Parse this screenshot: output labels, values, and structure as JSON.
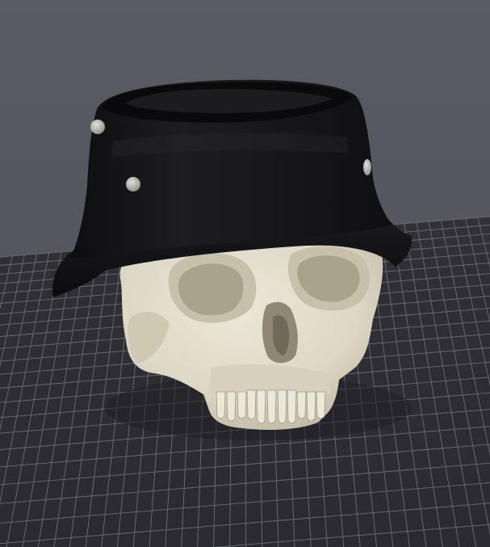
{
  "scene": {
    "background_color": "#56565e",
    "bed_color": "#2d2d33",
    "grid_color": "#6c6c74",
    "skull_color": "#e2ddcb",
    "helmet_color": "#141416",
    "rivet_color": "#b9b9b4",
    "objects": [
      "build-plate-grid",
      "skull-model",
      "helmet-model"
    ]
  }
}
